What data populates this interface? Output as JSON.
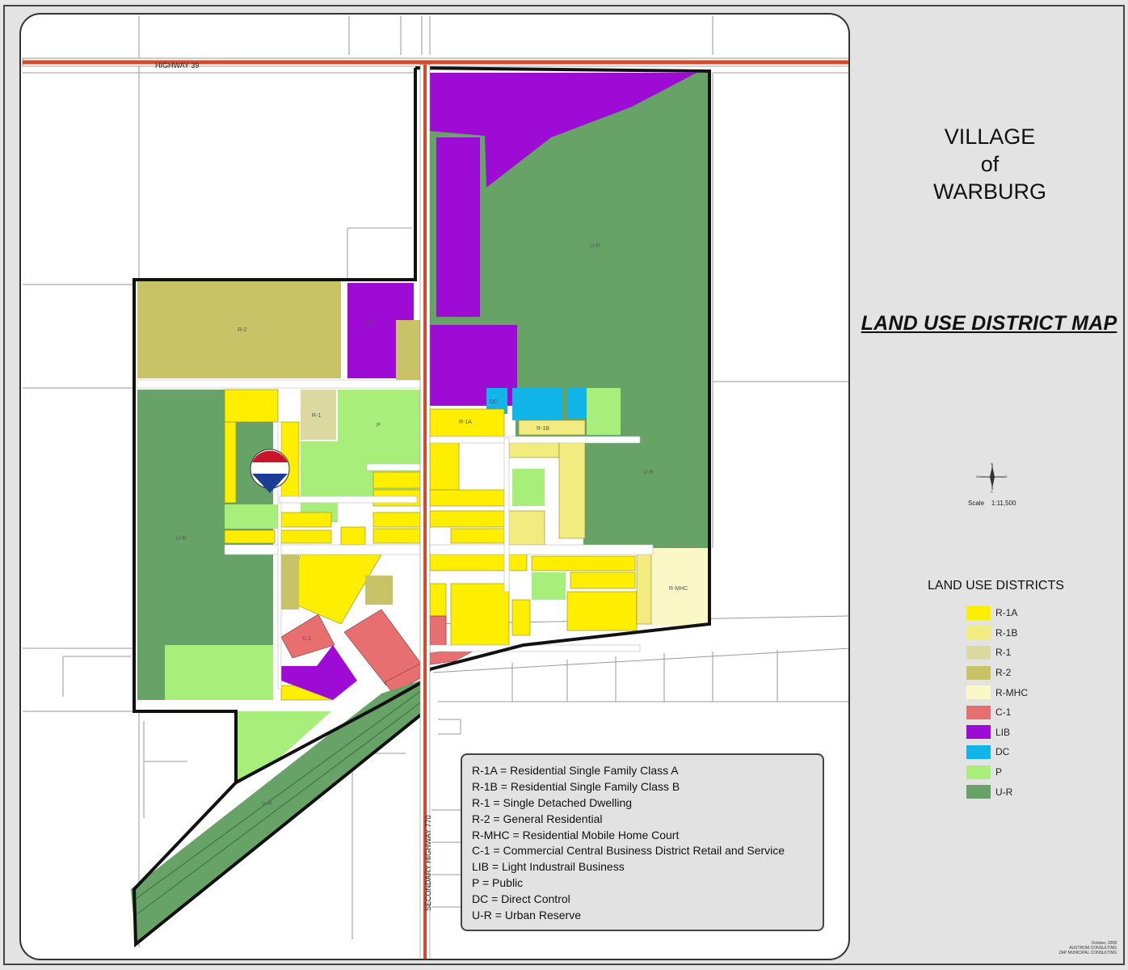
{
  "title": {
    "line1": "VILLAGE",
    "line2": "of",
    "line3": "WARBURG"
  },
  "map_heading": "LAND USE DISTRICT MAP",
  "scale_label": "Scale",
  "scale_value": "1:11,500",
  "roads": {
    "highway_39": "HIGHWAY 39",
    "secondary_highway": "SECONDARY HIGHWAY 770"
  },
  "legend": {
    "title": "LAND USE DISTRICTS",
    "items": [
      {
        "code": "R-1A",
        "color": "#ffee00"
      },
      {
        "code": "R-1B",
        "color": "#f2ec80"
      },
      {
        "code": "R-1",
        "color": "#dcd9a0"
      },
      {
        "code": "R-2",
        "color": "#c8c366"
      },
      {
        "code": "R-MHC",
        "color": "#fbf8c8"
      },
      {
        "code": "C-1",
        "color": "#e86f6f"
      },
      {
        "code": "LIB",
        "color": "#9d0bd4"
      },
      {
        "code": "DC",
        "color": "#11b5ea"
      },
      {
        "code": "P",
        "color": "#a8ee7a"
      },
      {
        "code": "U-R",
        "color": "#67a366"
      }
    ]
  },
  "definitions": [
    "R-1A  =  Residential Single Family Class A",
    "R-1B  =  Residential Single Family Class B",
    "R-1  =  Single Detached Dwelling",
    "R-2  =  General Residential",
    "R-MHC  =  Residential Mobile Home Court",
    "C-1  =  Commercial Central Business District Retail and Service",
    "LIB  =  Light Industrail Business",
    "P  =  Public",
    "DC  =  Direct Control",
    "U-R  =  Urban Reserve"
  ],
  "zone_labels": {
    "r2": "R-2",
    "lib": "LIB",
    "ur": "U-R",
    "r1": "R-1",
    "p": "P",
    "dc": "DC",
    "r1a": "R-1A",
    "r1b": "R-1B",
    "rmhc": "R-MHC",
    "c1": "C-1"
  },
  "credits": {
    "line1": "October, 2008",
    "line2": "AUSTROM CONSULTING",
    "line3": "ZAP MUNICIPAL CONSULTING"
  }
}
